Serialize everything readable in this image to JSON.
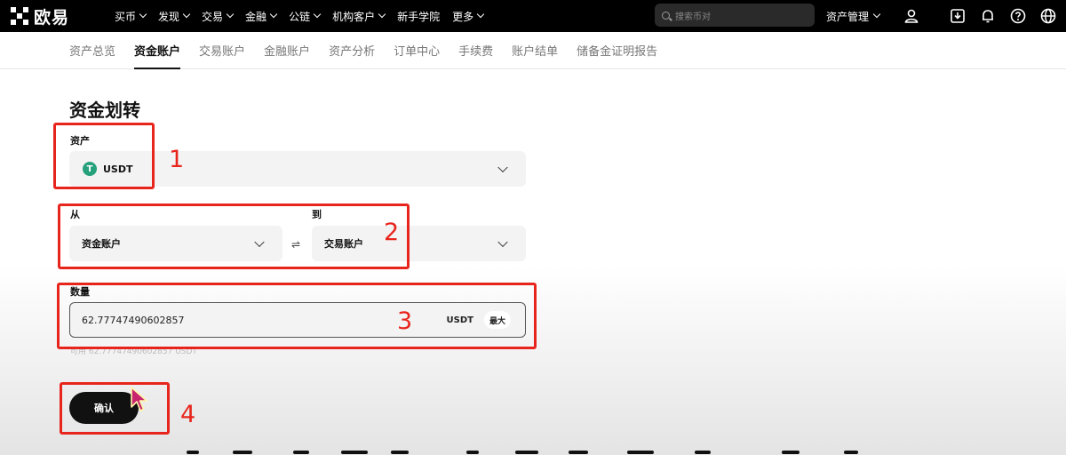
{
  "header": {
    "brand": "欧易",
    "nav": [
      {
        "label": "买币",
        "dropdown": true
      },
      {
        "label": "发现",
        "dropdown": true
      },
      {
        "label": "交易",
        "dropdown": true
      },
      {
        "label": "金融",
        "dropdown": true
      },
      {
        "label": "公链",
        "dropdown": true
      },
      {
        "label": "机构客户",
        "dropdown": true
      },
      {
        "label": "新手学院",
        "dropdown": false
      },
      {
        "label": "更多",
        "dropdown": true
      }
    ],
    "search_placeholder": "搜索币对",
    "asset_menu": "资产管理",
    "icons": [
      "user-icon",
      "download-icon",
      "bell-icon",
      "help-icon",
      "globe-icon"
    ]
  },
  "subnav": {
    "items": [
      "资产总览",
      "资金账户",
      "交易账户",
      "金融账户",
      "资产分析",
      "订单中心",
      "手续费",
      "账户结单",
      "储备金证明报告"
    ],
    "active": "资金账户"
  },
  "form": {
    "title": "资金划转",
    "asset_label": "资产",
    "asset_value": "USDT",
    "asset_icon_letter": "T",
    "from_label": "从",
    "from_value": "资金账户",
    "to_label": "到",
    "to_value": "交易账户",
    "swap_symbol": "⇌",
    "amount_label": "数量",
    "amount_value": "62.77747490602857",
    "amount_unit": "USDT",
    "max_label": "最大",
    "available_text": "可用 62.77747490602857 USDT",
    "confirm_label": "确认"
  },
  "annotations": {
    "numbers": [
      "1",
      "2",
      "3",
      "4"
    ],
    "color": "#e8251c"
  },
  "colors": {
    "topbar_bg": "#000000",
    "tether_green": "#26a17b",
    "button_bg": "#111111"
  }
}
